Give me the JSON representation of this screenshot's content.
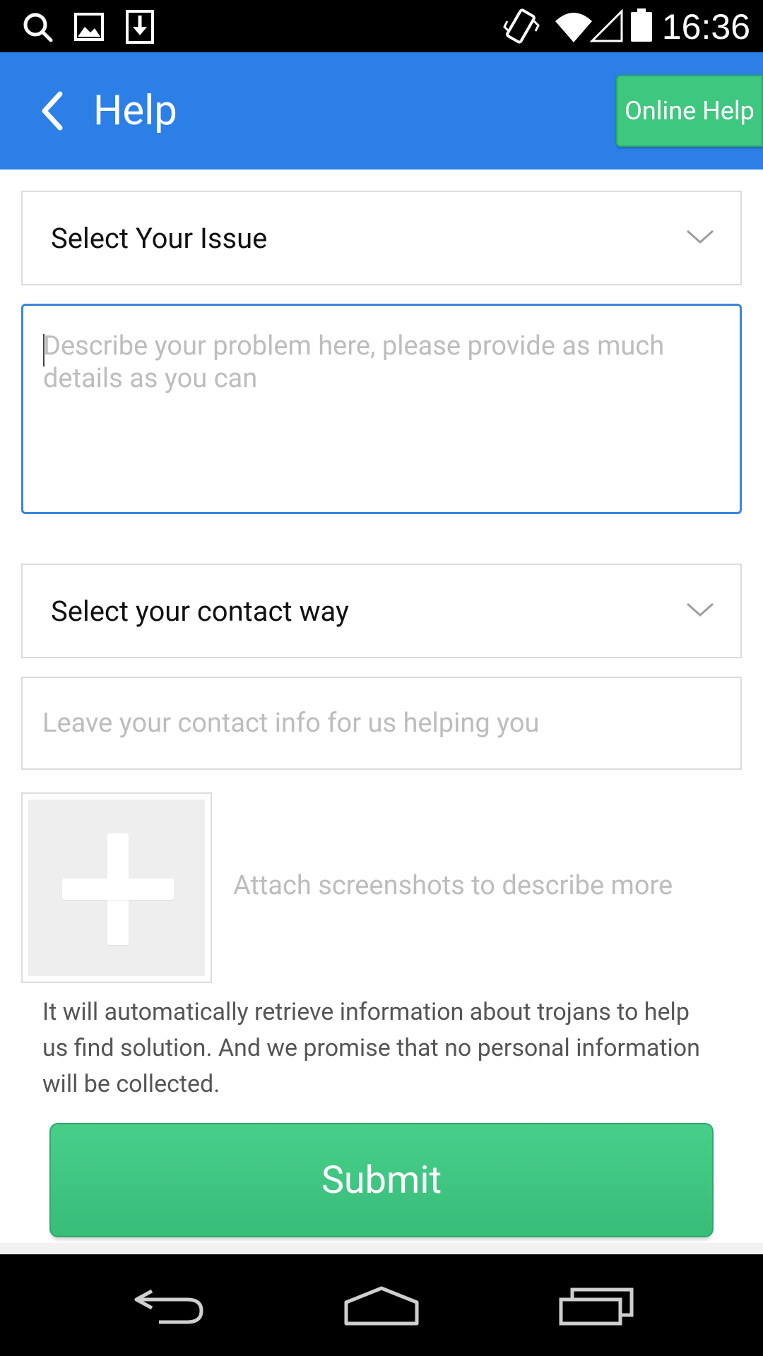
{
  "status_bar": {
    "time": "16:36",
    "icons": [
      "search-icon",
      "image-icon",
      "download-icon",
      "vibrate-icon",
      "wifi-icon",
      "signal-icon",
      "battery-icon"
    ]
  },
  "app_bar": {
    "title": "Help",
    "online_help_label": "Online Help",
    "color": "#2b7fe6"
  },
  "form": {
    "issue_select_label": "Select Your Issue",
    "problem_placeholder": "Describe your problem here, please provide as much details as you can",
    "contact_select_label": "Select your contact way",
    "contact_placeholder": "Leave your contact info for us helping you",
    "attach_label": "Attach screenshots to describe more",
    "notice": "It will automatically retrieve information about trojans to help us find solution. And we promise that no personal information will be collected.",
    "submit_label": "Submit",
    "accent_green": "#3ec77f"
  },
  "nav_bar": {
    "buttons": [
      "back-icon",
      "home-icon",
      "recent-apps-icon"
    ]
  }
}
